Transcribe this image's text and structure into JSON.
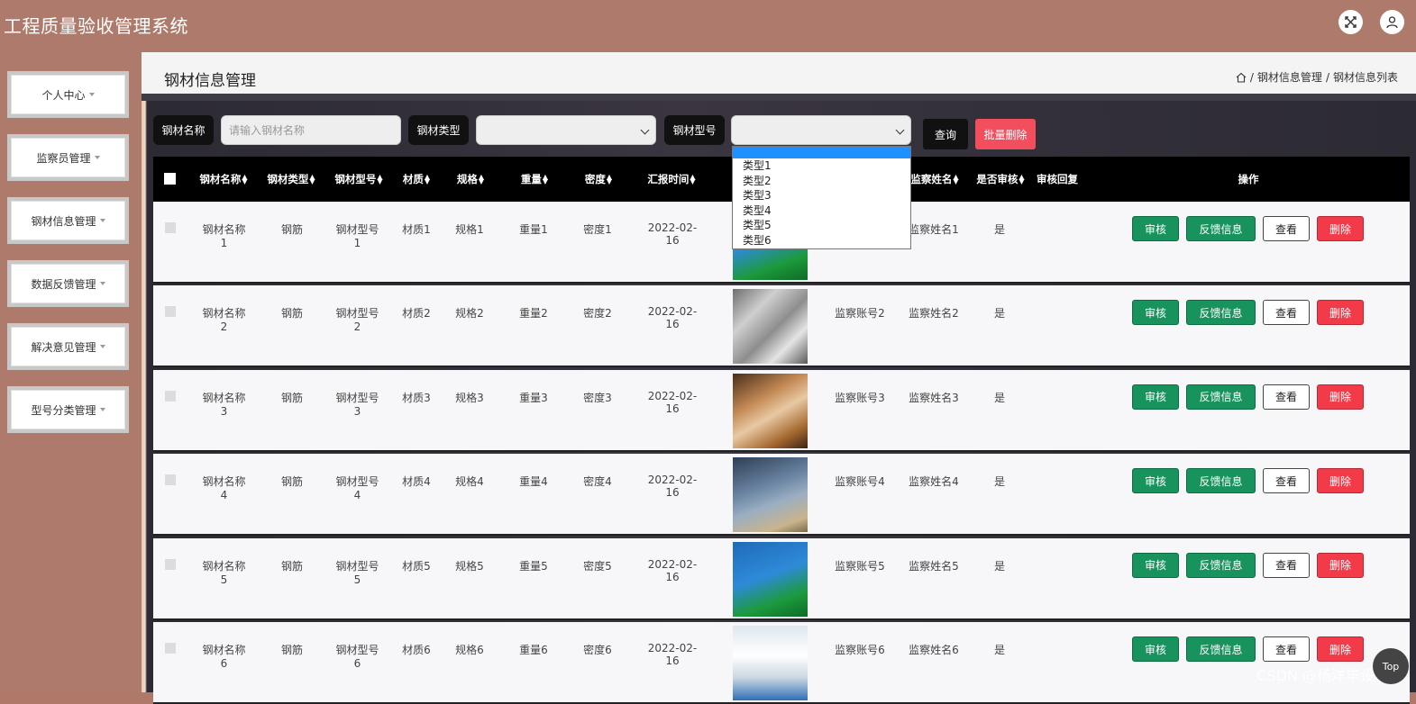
{
  "app": {
    "title": "工程质量验收管理系统"
  },
  "sidebar": {
    "items": [
      {
        "label": "个人中心"
      },
      {
        "label": "监察员管理"
      },
      {
        "label": "钢材信息管理"
      },
      {
        "label": "数据反馈管理"
      },
      {
        "label": "解决意见管理"
      },
      {
        "label": "型号分类管理"
      }
    ]
  },
  "page": {
    "title": "钢材信息管理",
    "breadcrumb": [
      "钢材信息管理",
      "钢材信息列表"
    ]
  },
  "search": {
    "name_label": "钢材名称",
    "name_placeholder": "请输入钢材名称",
    "type_label": "钢材类型",
    "model_label": "钢材型号",
    "query_button": "查询",
    "batch_delete_button": "批量删除"
  },
  "dropdown": {
    "options": [
      "",
      "类型1",
      "类型2",
      "类型3",
      "类型4",
      "类型5",
      "类型6"
    ]
  },
  "table": {
    "columns": [
      "钢材名称",
      "钢材类型",
      "钢材型号",
      "材质",
      "规格",
      "重量",
      "密度",
      "汇报时间",
      "监察姓名",
      "是否审核",
      "审核回复",
      "操作"
    ],
    "rows": [
      {
        "name": "钢材名称1",
        "type": "钢筋",
        "model": "钢材型号1",
        "material": "材质1",
        "spec": "规格1",
        "weight": "重量1",
        "density": "密度1",
        "date": "2022-02-16",
        "account": "",
        "inspector": "监察姓名1",
        "audited": "是",
        "reply": ""
      },
      {
        "name": "钢材名称2",
        "type": "钢筋",
        "model": "钢材型号2",
        "material": "材质2",
        "spec": "规格2",
        "weight": "重量2",
        "density": "密度2",
        "date": "2022-02-16",
        "account": "监察账号2",
        "inspector": "监察姓名2",
        "audited": "是",
        "reply": ""
      },
      {
        "name": "钢材名称3",
        "type": "钢筋",
        "model": "钢材型号3",
        "material": "材质3",
        "spec": "规格3",
        "weight": "重量3",
        "density": "密度3",
        "date": "2022-02-16",
        "account": "监察账号3",
        "inspector": "监察姓名3",
        "audited": "是",
        "reply": ""
      },
      {
        "name": "钢材名称4",
        "type": "钢筋",
        "model": "钢材型号4",
        "material": "材质4",
        "spec": "规格4",
        "weight": "重量4",
        "density": "密度4",
        "date": "2022-02-16",
        "account": "监察账号4",
        "inspector": "监察姓名4",
        "audited": "是",
        "reply": ""
      },
      {
        "name": "钢材名称5",
        "type": "钢筋",
        "model": "钢材型号5",
        "material": "材质5",
        "spec": "规格5",
        "weight": "重量5",
        "density": "密度5",
        "date": "2022-02-16",
        "account": "监察账号5",
        "inspector": "监察姓名5",
        "audited": "是",
        "reply": ""
      },
      {
        "name": "钢材名称6",
        "type": "钢筋",
        "model": "钢材型号6",
        "material": "材质6",
        "spec": "规格6",
        "weight": "重量6",
        "density": "密度6",
        "date": "2022-02-16",
        "account": "监察账号6",
        "inspector": "监察姓名6",
        "audited": "是",
        "reply": ""
      }
    ],
    "actions": {
      "audit": "审核",
      "feedback": "反馈信息",
      "view": "查看",
      "delete": "删除"
    }
  },
  "watermark": "CSDN @杨洋毕设项目",
  "fab": {
    "label": "Top"
  },
  "colors": {
    "topbar": "#ad7a6b",
    "green": "#19935d",
    "red": "#f23a48",
    "highlight": "#1e90ff"
  }
}
